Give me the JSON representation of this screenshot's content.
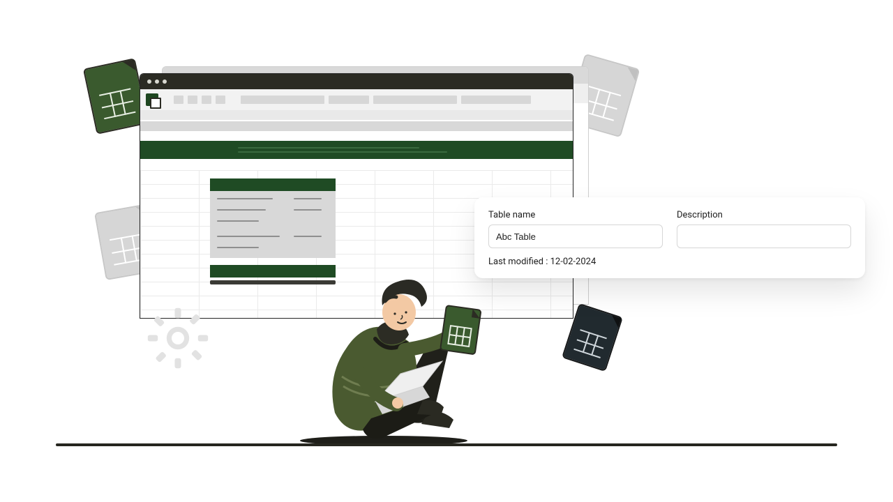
{
  "form": {
    "table_name_label": "Table name",
    "table_name_value": "Abc Table",
    "description_label": "Description",
    "description_value": "",
    "last_modified_label": "Last modified :",
    "last_modified_value": "12-02-2024"
  },
  "colors": {
    "brand_green": "#1f4b24",
    "olive": "#3a5a2e",
    "dark": "#2b2b23"
  }
}
